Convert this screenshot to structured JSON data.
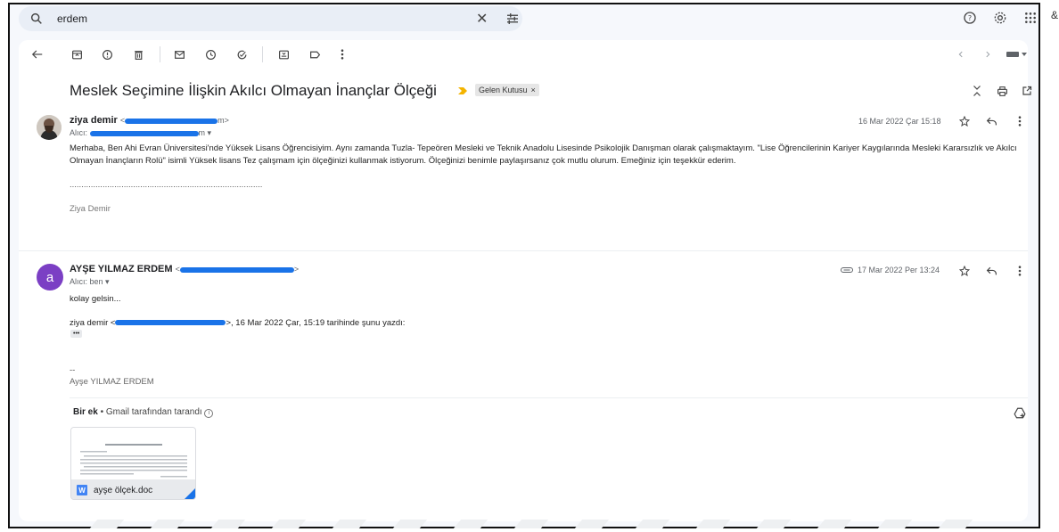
{
  "search": {
    "query": "erdem"
  },
  "thread": {
    "subject": "Meslek Seçimine İlişkin Akılcı Olmayan İnançlar Ölçeği",
    "label": "Gelen Kutusu",
    "label_close": "×"
  },
  "messages": [
    {
      "sender_name": "ziya demir",
      "addr_prefix": "<",
      "addr_suffix": "m>",
      "to_label": "Alıcı:",
      "to_suffix": "m",
      "date": "16 Mar 2022 Çar 15:18",
      "body": "Merhaba, Ben Ahi Evran Üniversitesi'nde Yüksek Lisans Öğrencisiyim. Aynı zamanda Tuzla- Tepeören Mesleki ve Teknik Anadolu Lisesinde Psikolojik Danışman olarak çalışmaktayım. \"Lise Öğrencilerinin Kariyer Kaygılarında Mesleki Kararsızlık ve Akılcı Olmayan İnançların Rolü\" isimli Yüksek lisans Tez çalışmam için ölçeğinizi kullanmak istiyorum. Ölçeğinizi benimle paylaşırsanız çok mutlu olurum. Emeğiniz için teşekkür ederim.",
      "dots": "..................................................................................",
      "signature": "Ziya Demir"
    },
    {
      "avatar_letter": "a",
      "sender_name": "AYŞE YILMAZ ERDEM",
      "addr_prefix": "<",
      "addr_suffix": ">",
      "to_label": "Alıcı: ben",
      "date": "17 Mar 2022 Per 13:24",
      "body": "kolay gelsin...",
      "quote_prefix": "ziya demir <",
      "quote_suffix": ">, 16 Mar 2022 Çar, 15:19 tarihinde şunu yazdı:",
      "ellipsis": "•••",
      "sig_sep": "--",
      "signature": "Ayşe YILMAZ ERDEM"
    }
  ],
  "attachment": {
    "count_label": "Bir ek",
    "scan_label": "• Gmail tarafından tarandı",
    "file_type": "W",
    "file_name": "ayşe ölçek.doc"
  },
  "colors": {
    "redaction": "#1a73e8",
    "avatar": "#7b3fc4",
    "label_marker": "#f4b400"
  },
  "outer_char": "&"
}
